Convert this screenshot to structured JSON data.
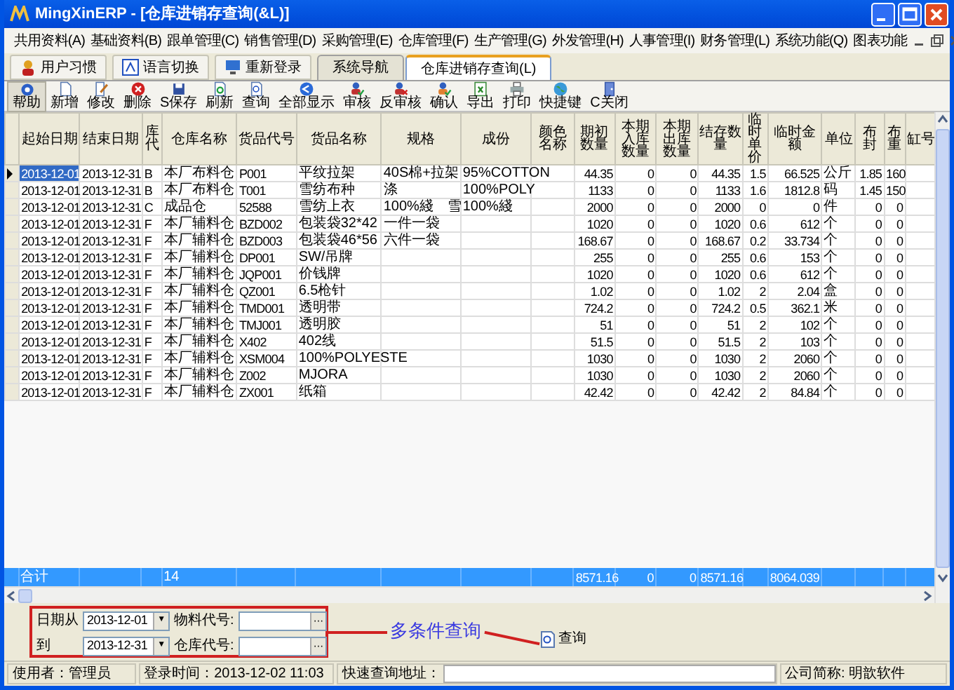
{
  "window": {
    "title": "MingXinERP - [仓库进销存查询(&L)]"
  },
  "menu": [
    "共用资料(A)",
    "基础资料(B)",
    "跟单管理(C)",
    "销售管理(D)",
    "采购管理(E)",
    "仓库管理(F)",
    "生产管理(G)",
    "外发管理(H)",
    "人事管理(I)",
    "财务管理(L)",
    "系统功能(Q)",
    "图表功能"
  ],
  "tabs": [
    {
      "label": "用户习惯",
      "kind": "button",
      "selected": false
    },
    {
      "label": "语言切换",
      "kind": "button",
      "selected": false
    },
    {
      "label": "重新登录",
      "kind": "button",
      "selected": false
    },
    {
      "label": "系统导航",
      "kind": "tab",
      "selected": false
    },
    {
      "label": "仓库进销存查询(L)",
      "kind": "tab",
      "selected": true
    }
  ],
  "toolbar": [
    "帮助",
    "新增",
    "修改",
    "删除",
    "S保存",
    "刷新",
    "查询",
    "全部显示",
    "审核",
    "反审核",
    "确认",
    "导出",
    "打印",
    "快捷键",
    "C关闭"
  ],
  "table": {
    "columns": [
      "起始日期",
      "结束日期",
      "库代",
      "仓库名称",
      "货品代号",
      "货品名称",
      "规格",
      "成份",
      "颜色名称",
      "期初数量",
      "本期入库数量",
      "本期出库数量",
      "结存数量",
      "临时单价",
      "临时金额",
      "单位",
      "布封",
      "布重",
      "缸号"
    ],
    "rows": [
      {
        "current": true,
        "cells": [
          "2013-12-01",
          "2013-12-31",
          "B",
          "本厂布料仓",
          "P001",
          "平纹拉架",
          "40S棉+拉架",
          "95%COTTON",
          "",
          "44.35",
          "0",
          "0",
          "44.35",
          "1.5",
          "66.525",
          "公斤",
          "1.85",
          "160",
          ""
        ]
      },
      {
        "current": false,
        "cells": [
          "2013-12-01",
          "2013-12-31",
          "B",
          "本厂布料仓",
          "T001",
          "雪纺布种",
          "涤",
          "100%POLY",
          "",
          "1133",
          "0",
          "0",
          "1133",
          "1.6",
          "1812.8",
          "码",
          "1.45",
          "150",
          ""
        ]
      },
      {
        "current": false,
        "cells": [
          "2013-12-01",
          "2013-12-31",
          "C",
          "成品仓",
          "52588",
          "雪纺上衣",
          "100%綫　雪",
          "100%綫",
          "",
          "2000",
          "0",
          "0",
          "2000",
          "0",
          "0",
          "件",
          "0",
          "0",
          ""
        ]
      },
      {
        "current": false,
        "cells": [
          "2013-12-01",
          "2013-12-31",
          "F",
          "本厂辅料仓",
          "BZD002",
          "包装袋32*42",
          "一件一袋",
          "",
          "",
          "1020",
          "0",
          "0",
          "1020",
          "0.6",
          "612",
          "个",
          "0",
          "0",
          ""
        ]
      },
      {
        "current": false,
        "cells": [
          "2013-12-01",
          "2013-12-31",
          "F",
          "本厂辅料仓",
          "BZD003",
          "包装袋46*56",
          "六件一袋",
          "",
          "",
          "168.67",
          "0",
          "0",
          "168.67",
          "0.2",
          "33.734",
          "个",
          "0",
          "0",
          ""
        ]
      },
      {
        "current": false,
        "cells": [
          "2013-12-01",
          "2013-12-31",
          "F",
          "本厂辅料仓",
          "DP001",
          "SW/吊牌",
          "",
          "",
          "",
          "255",
          "0",
          "0",
          "255",
          "0.6",
          "153",
          "个",
          "0",
          "0",
          ""
        ]
      },
      {
        "current": false,
        "cells": [
          "2013-12-01",
          "2013-12-31",
          "F",
          "本厂辅料仓",
          "JQP001",
          "价钱牌",
          "",
          "",
          "",
          "1020",
          "0",
          "0",
          "1020",
          "0.6",
          "612",
          "个",
          "0",
          "0",
          ""
        ]
      },
      {
        "current": false,
        "cells": [
          "2013-12-01",
          "2013-12-31",
          "F",
          "本厂辅料仓",
          "QZ001",
          "6.5枪针",
          "",
          "",
          "",
          "1.02",
          "0",
          "0",
          "1.02",
          "2",
          "2.04",
          "盒",
          "0",
          "0",
          ""
        ]
      },
      {
        "current": false,
        "cells": [
          "2013-12-01",
          "2013-12-31",
          "F",
          "本厂辅料仓",
          "TMD001",
          "透明带",
          "",
          "",
          "",
          "724.2",
          "0",
          "0",
          "724.2",
          "0.5",
          "362.1",
          "米",
          "0",
          "0",
          ""
        ]
      },
      {
        "current": false,
        "cells": [
          "2013-12-01",
          "2013-12-31",
          "F",
          "本厂辅料仓",
          "TMJ001",
          "透明胶",
          "",
          "",
          "",
          "51",
          "0",
          "0",
          "51",
          "2",
          "102",
          "个",
          "0",
          "0",
          ""
        ]
      },
      {
        "current": false,
        "cells": [
          "2013-12-01",
          "2013-12-31",
          "F",
          "本厂辅料仓",
          "X402",
          "402线",
          "",
          "",
          "",
          "51.5",
          "0",
          "0",
          "51.5",
          "2",
          "103",
          "个",
          "0",
          "0",
          ""
        ]
      },
      {
        "current": false,
        "cells": [
          "2013-12-01",
          "2013-12-31",
          "F",
          "本厂辅料仓",
          "XSM004",
          "100%POLYESTE",
          "",
          "",
          "",
          "1030",
          "0",
          "0",
          "1030",
          "2",
          "2060",
          "个",
          "0",
          "0",
          ""
        ]
      },
      {
        "current": false,
        "cells": [
          "2013-12-01",
          "2013-12-31",
          "F",
          "本厂辅料仓",
          "Z002",
          "MJORA",
          "",
          "",
          "",
          "1030",
          "0",
          "0",
          "1030",
          "2",
          "2060",
          "个",
          "0",
          "0",
          ""
        ]
      },
      {
        "current": false,
        "cells": [
          "2013-12-01",
          "2013-12-31",
          "F",
          "本厂辅料仓",
          "ZX001",
          "纸箱",
          "",
          "",
          "",
          "42.42",
          "0",
          "0",
          "42.42",
          "2",
          "84.84",
          "个",
          "0",
          "0",
          ""
        ]
      }
    ],
    "totals": {
      "label": "合计",
      "row_count": "14",
      "opening_qty": "8571.16",
      "in_qty": "0",
      "out_qty": "0",
      "balance_qty": "8571.16",
      "amount": "8064.039"
    }
  },
  "search": {
    "fields": [
      {
        "label": "日期从",
        "value": "2013-12-01",
        "kind": "date"
      },
      {
        "label": "物料代号:",
        "kind": "lookup"
      },
      {
        "label": "到",
        "value": "2013-12-31",
        "kind": "date"
      },
      {
        "label": "仓库代号:",
        "kind": "lookup"
      }
    ],
    "dropdown_glyph": "▼",
    "lookup_glyph": "···",
    "annotation": "多条件查询",
    "query_button": "查询"
  },
  "status_bar": [
    {
      "label": "使用者：管理员",
      "kind": "text"
    },
    {
      "label": "登录时间：2013-12-02 11:03",
      "kind": "text"
    },
    {
      "label": "快速查询地址：",
      "kind": "field"
    },
    {
      "label": "公司简称: 明歆软件",
      "kind": "text"
    }
  ]
}
